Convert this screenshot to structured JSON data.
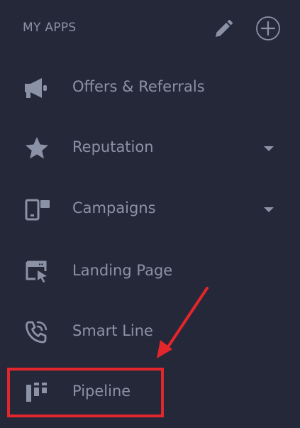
{
  "header": {
    "title": "MY APPS"
  },
  "icons": {
    "edit": "pencil-icon",
    "add": "plus-circle-icon"
  },
  "colors": {
    "background": "#252839",
    "text": "#8c92a6",
    "annotation": "#e3262b"
  },
  "nav": {
    "items": [
      {
        "label": "Offers & Referrals",
        "icon": "megaphone-icon",
        "has_caret": false
      },
      {
        "label": "Reputation",
        "icon": "star-icon",
        "has_caret": true
      },
      {
        "label": "Campaigns",
        "icon": "devices-icon",
        "has_caret": true
      },
      {
        "label": "Landing Page",
        "icon": "browser-cursor-icon",
        "has_caret": false
      },
      {
        "label": "Smart Line",
        "icon": "phone-icon",
        "has_caret": false
      },
      {
        "label": "Pipeline",
        "icon": "pipeline-icon",
        "has_caret": false
      }
    ]
  }
}
